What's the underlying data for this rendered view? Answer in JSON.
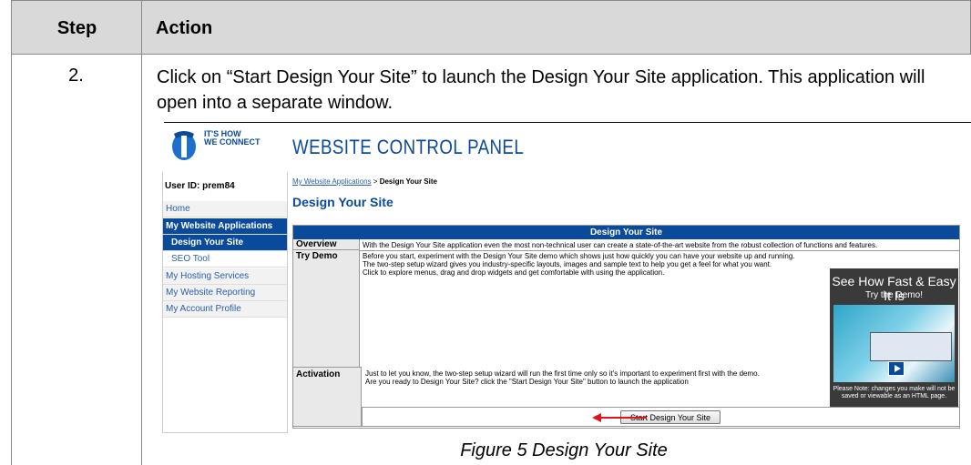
{
  "table": {
    "header_step": "Step",
    "header_action": "Action",
    "step_number": "2.",
    "action_text": "Click on “Start Design Your Site” to launch the Design Your Site application. This application will open into a separate window.",
    "caption": "Figure 5 Design Your Site"
  },
  "screenshot": {
    "logo_tagline_1": "IT'S HOW",
    "logo_tagline_2": "WE CONNECT",
    "panel_title": "WEBSITE CONTROL PANEL",
    "user_id": "User ID: prem84",
    "nav": {
      "home": "Home",
      "apps": "My Website Applications",
      "design": "Design Your Site",
      "seo": "SEO Tool",
      "hosting": "My Hosting Services",
      "reporting": "My Website Reporting",
      "account": "My Account Profile"
    },
    "breadcrumb_link": "My Website Applications",
    "breadcrumb_sep": " > ",
    "breadcrumb_current": "Design Your Site",
    "page_heading": "Design Your Site",
    "table_header": "Design Your Site",
    "overview_label": "Overview",
    "overview_text": "With the Design Your Site application even the most non-technical user can create a state-of-the-art website from the robust collection of functions and features.",
    "try_demo_label": "Try Demo",
    "try_demo_line1": "Before you start, experiment with the Design Your Site demo which shows just how quickly you can have your website up and running.",
    "try_demo_line2": "The two-step setup wizard gives you industry-specific layouts, images and sample text to help you get a feel for what you want.",
    "try_demo_line3": "Click to explore menus, drag and drop widgets and get comfortable with using the application.",
    "promo_title": "See How Fast & Easy It Is",
    "promo_subtitle": "Try the Demo!",
    "promo_note": "Please Note: changes you make will not be saved or viewable as an HTML page.",
    "activation_label": "Activation",
    "activation_line1": "Just to let you know, the two-step setup wizard will run the first time only so it's important to experiment first with the demo.",
    "activation_line2": "Are you ready to Design Your Site? click the \"Start Design Your Site\" button to launch the application",
    "start_button": "Start Design Your Site"
  },
  "colors": {
    "brand_blue": "#0a4a9a",
    "header_gray": "#d9d9d9",
    "arrow_red": "#e0141e"
  }
}
